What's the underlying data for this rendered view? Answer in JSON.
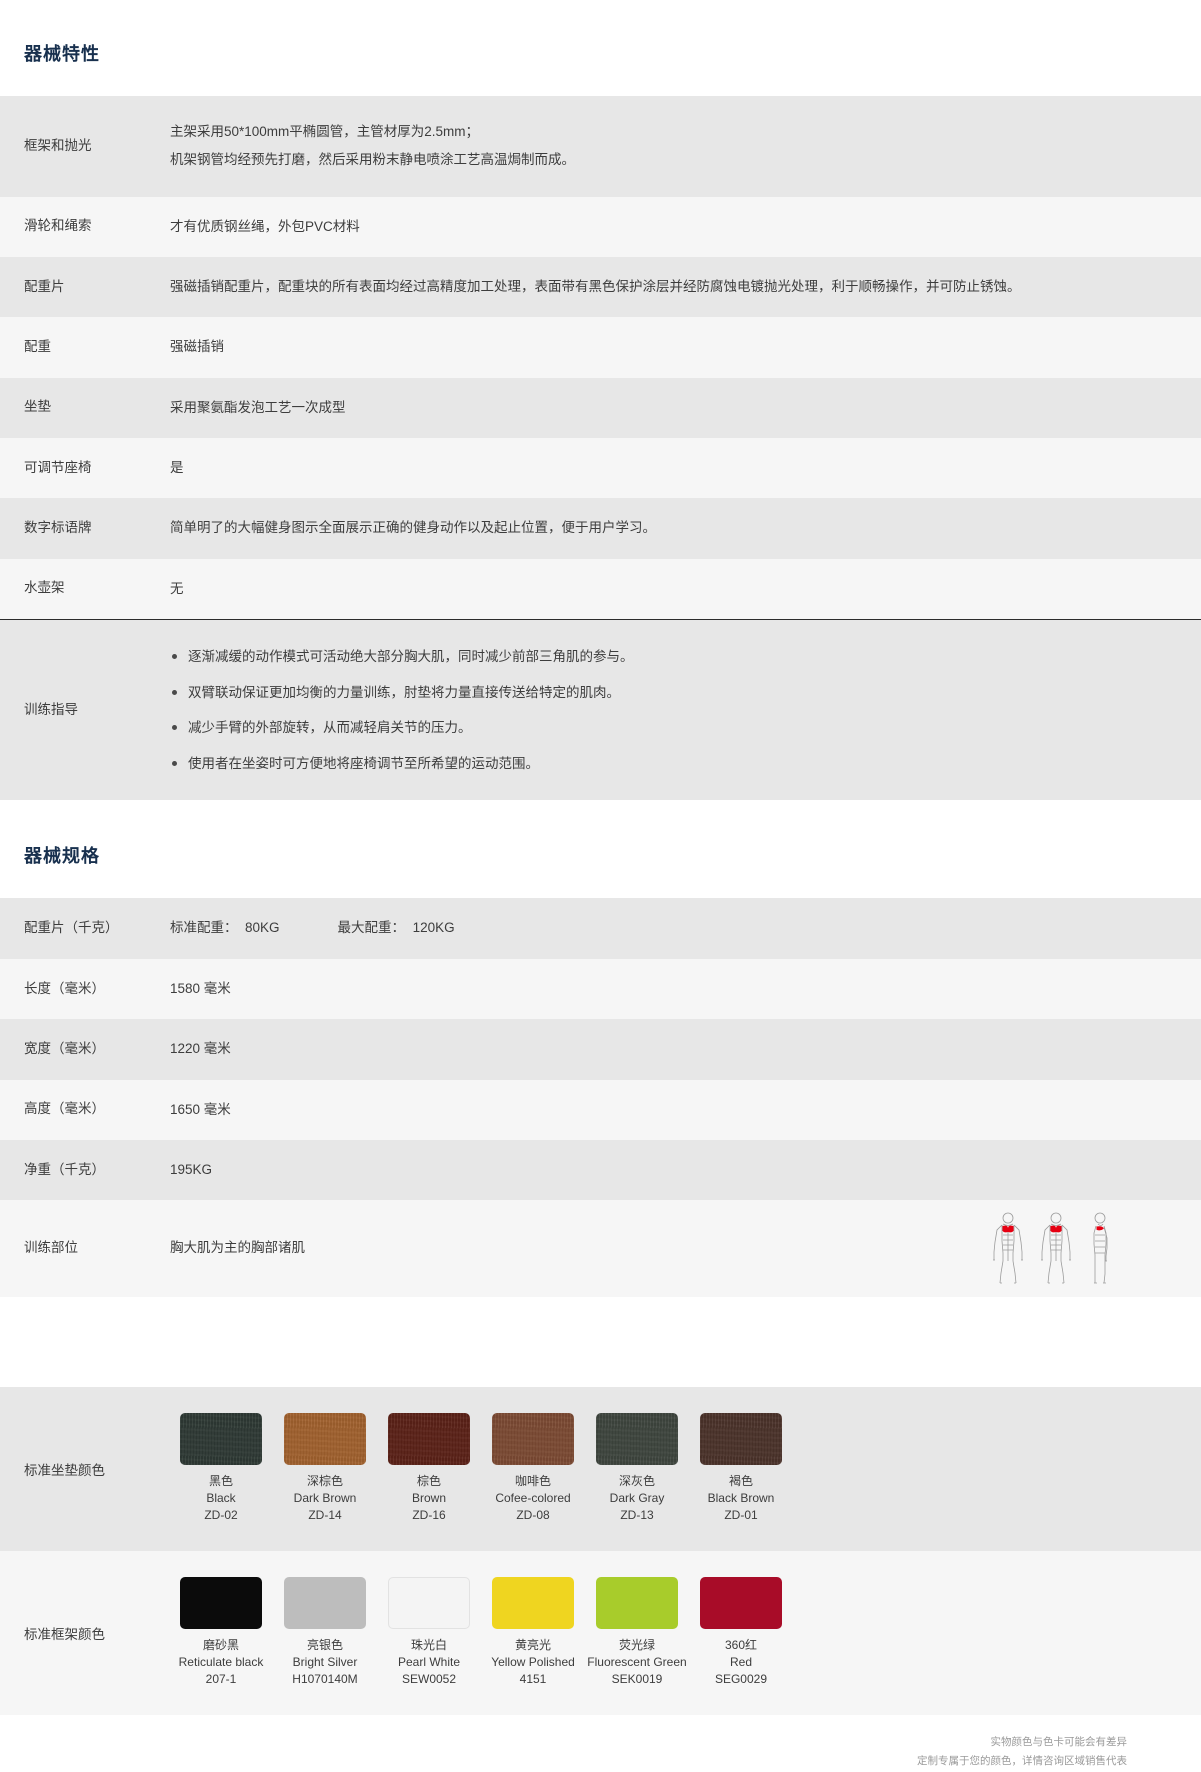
{
  "sections": {
    "features_title": "器械特性",
    "specs_title": "器械规格"
  },
  "features": [
    {
      "label": "框架和抛光",
      "lines": [
        "主架采用50*100mm平椭圆管，主管材厚为2.5mm；",
        "机架钢管均经预先打磨，然后采用粉末静电喷涂工艺高温焗制而成。"
      ]
    },
    {
      "label": "滑轮和绳索",
      "lines": [
        "才有优质钢丝绳，外包PVC材料"
      ]
    },
    {
      "label": "配重片",
      "lines": [
        "强磁插销配重片，配重块的所有表面均经过高精度加工处理，表面带有黑色保护涂层并经防腐蚀电镀抛光处理，利于顺畅操作，并可防止锈蚀。"
      ]
    },
    {
      "label": "配重",
      "lines": [
        "强磁插销"
      ]
    },
    {
      "label": "坐垫",
      "lines": [
        "采用聚氨酯发泡工艺一次成型"
      ]
    },
    {
      "label": "可调节座椅",
      "lines": [
        "是"
      ]
    },
    {
      "label": "数字标语牌",
      "lines": [
        "简单明了的大幅健身图示全面展示正确的健身动作以及起止位置，便于用户学习。"
      ]
    },
    {
      "label": " 水壶架",
      "lines": [
        "无"
      ]
    }
  ],
  "training_guide": {
    "label": "训练指导",
    "items": [
      "逐渐减缓的动作模式可活动绝大部分胸大肌，同时减少前部三角肌的参与。",
      "双臂联动保证更加均衡的力量训练，肘垫将力量直接传送给特定的肌肉。",
      "减少手臂的外部旋转，从而减轻肩关节的压力。",
      "使用者在坐姿时可方便地将座椅调节至所希望的运动范围。"
    ]
  },
  "specs": {
    "weight_stack": {
      "label": "配重片（千克）",
      "standard_label": "标准配重：",
      "standard_value": "80KG",
      "max_label": "最大配重：",
      "max_value": "120KG"
    },
    "rows": [
      {
        "label": "长度（毫米）",
        "value": "1580 毫米"
      },
      {
        "label": "宽度（毫米）",
        "value": "1220 毫米"
      },
      {
        "label": "高度（毫米）",
        "value": "1650 毫米"
      },
      {
        "label": "净重（千克）",
        "value": "195KG"
      }
    ],
    "training_area": {
      "label": "训练部位",
      "value": "胸大肌为主的胸部诸肌"
    }
  },
  "seat_colors": {
    "label": "标准坐垫颜色",
    "items": [
      {
        "cn": "黑色",
        "en": "Black",
        "code": "ZD-02",
        "hex": "#2f3a35"
      },
      {
        "cn": "深棕色",
        "en": "Dark Brown",
        "code": "ZD-14",
        "hex": "#a2622f"
      },
      {
        "cn": "棕色",
        "en": "Brown",
        "code": "ZD-16",
        "hex": "#5c2218"
      },
      {
        "cn": "咖啡色",
        "en": "Cofee-colored",
        "code": "ZD-08",
        "hex": "#7d4b34"
      },
      {
        "cn": "深灰色",
        "en": "Dark Gray",
        "code": "ZD-13",
        "hex": "#3f463f"
      },
      {
        "cn": "褐色",
        "en": "Black Brown",
        "code": "ZD-01",
        "hex": "#4c332b"
      }
    ]
  },
  "frame_colors": {
    "label": "标准框架颜色",
    "items": [
      {
        "cn": "磨砂黑",
        "en": "Reticulate black",
        "code": "207-1",
        "hex": "#0b0b0b"
      },
      {
        "cn": "亮银色",
        "en": "Bright Silver",
        "code": "H1070140M",
        "hex": "#bdbdbd"
      },
      {
        "cn": "珠光白",
        "en": "Pearl White",
        "code": "SEW0052",
        "hex": "#f4f4f4"
      },
      {
        "cn": "黄亮光",
        "en": "Yellow Polished",
        "code": "4151",
        "hex": "#efd520"
      },
      {
        "cn": "荧光绿",
        "en": "Fluorescent Green",
        "code": "SEK0019",
        "hex": "#a8cc2b"
      },
      {
        "cn": "360红",
        "en": "Red",
        "code": "SEG0029",
        "hex": "#a80c28"
      }
    ]
  },
  "footnote": {
    "line1": "实物颜色与色卡可能会有差异",
    "line2": "定制专属于您的颜色，详情咨询区域销售代表"
  },
  "colors": {
    "heading": "#18304e",
    "text": "#3d3d3d",
    "row_odd": "#e7e7e7",
    "row_even": "#f6f6f6",
    "muted": "#9a9a9a",
    "muscle_highlight": "#e60012"
  }
}
